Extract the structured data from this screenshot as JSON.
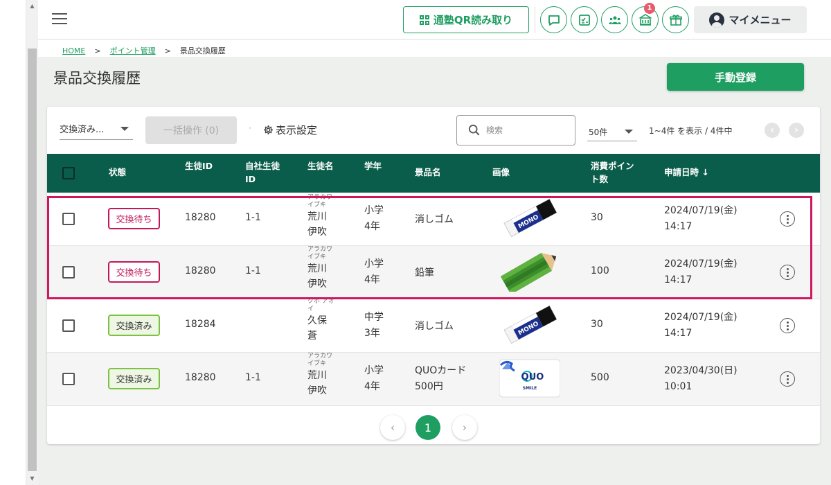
{
  "header": {
    "qr_button_label": "通塾QR読み取り",
    "notification_count": "1",
    "my_menu_label": "マイメニュー",
    "icons": [
      "chat-icon",
      "checklist-icon",
      "group-icon",
      "school-icon",
      "gift-icon"
    ]
  },
  "breadcrumb": {
    "home": "HOME",
    "sep": ">",
    "points": "ポイント管理",
    "current": "景品交換履歴"
  },
  "page": {
    "title": "景品交換履歴",
    "manual_register_label": "手動登録"
  },
  "toolbar": {
    "status_filter_value": "交換済み...",
    "bulk_action_label": "一括操作 (0)",
    "display_settings_label": "表示設定",
    "search_placeholder": "検索",
    "per_page_value": "50件",
    "range_text": "1~4件 を表示 / 4件中",
    "prev_symbol": "‹",
    "next_symbol": "›"
  },
  "table": {
    "columns": {
      "status": "状態",
      "student_id": "生徒ID",
      "own_id_line1": "自社生徒",
      "own_id_line2": "ID",
      "student_name": "生徒名",
      "grade": "学年",
      "prize": "景品名",
      "image": "画像",
      "points_line1": "消費ポイン",
      "points_line2": "ト数",
      "requested_at": "申請日時",
      "sort_arrow": "↓"
    },
    "rows": [
      {
        "status": "交換待ち",
        "status_type": "waiting",
        "student_id": "18280",
        "own_id": "1-1",
        "kana_1": "アラカワ",
        "kana_2": "イブキ",
        "name_1": "荒川",
        "name_2": "伊吹",
        "grade_1": "小学",
        "grade_2": "4年",
        "prize_1": "消しゴム",
        "prize_2": "",
        "image": "eraser-image",
        "points": "30",
        "date_1": "2024/07/19(金)",
        "date_2": "14:17"
      },
      {
        "status": "交換待ち",
        "status_type": "waiting",
        "student_id": "18280",
        "own_id": "1-1",
        "kana_1": "アラカワ",
        "kana_2": "イブキ",
        "name_1": "荒川",
        "name_2": "伊吹",
        "grade_1": "小学",
        "grade_2": "4年",
        "prize_1": "鉛筆",
        "prize_2": "",
        "image": "pencil-image",
        "points": "100",
        "date_1": "2024/07/19(金)",
        "date_2": "14:17"
      },
      {
        "status": "交換済み",
        "status_type": "done",
        "student_id": "18284",
        "own_id": "",
        "kana_1": "クボ アオ",
        "kana_2": "イ",
        "name_1": "久保",
        "name_2": "蒼",
        "grade_1": "中学",
        "grade_2": "3年",
        "prize_1": "消しゴム",
        "prize_2": "",
        "image": "eraser-image",
        "points": "30",
        "date_1": "2024/07/19(金)",
        "date_2": "14:17"
      },
      {
        "status": "交換済み",
        "status_type": "done",
        "student_id": "18280",
        "own_id": "1-1",
        "kana_1": "アラカワ",
        "kana_2": "イブキ",
        "name_1": "荒川",
        "name_2": "伊吹",
        "grade_1": "小学",
        "grade_2": "4年",
        "prize_1": "QUOカード",
        "prize_2": "500円",
        "image": "quo-card-image",
        "points": "500",
        "date_1": "2023/04/30(日)",
        "date_2": "10:01"
      }
    ]
  },
  "thumbnails": {
    "eraser_brand": "MONO",
    "quo_brand": "QUO",
    "quo_tagline": "SMILE"
  },
  "pagination": {
    "prev": "‹",
    "current": "1",
    "next": "›"
  },
  "colors": {
    "brand_green": "#1e9e60",
    "table_header": "#0a5d4a",
    "waiting": "#c2185b",
    "done": "#7cc242",
    "highlight": "#d0165e"
  }
}
